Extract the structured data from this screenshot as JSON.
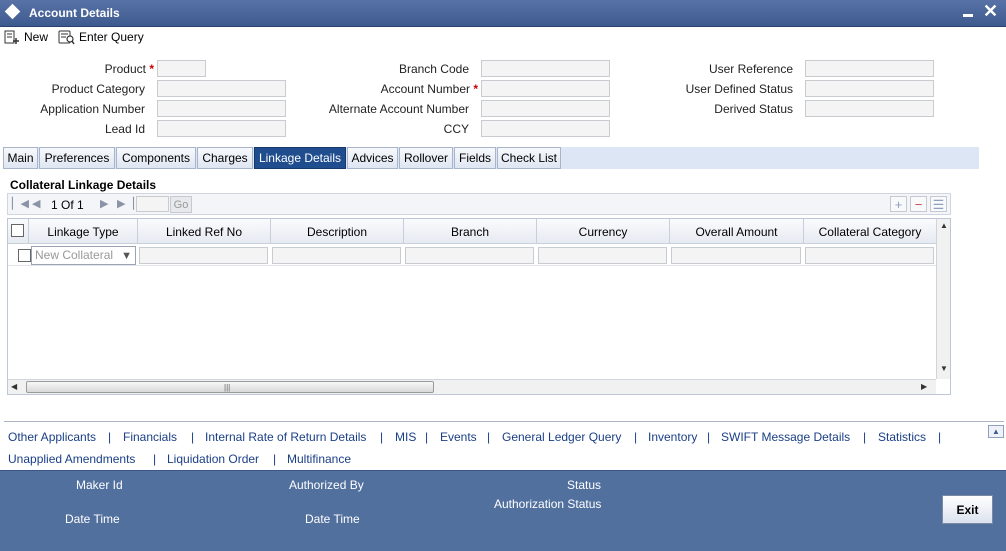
{
  "window": {
    "title": "Account Details"
  },
  "toolbar": {
    "new_label": "New",
    "enter_query_label": "Enter Query"
  },
  "form": {
    "product": "Product",
    "product_category": "Product Category",
    "application_number": "Application Number",
    "lead_id": "Lead Id",
    "branch_code": "Branch Code",
    "account_number": "Account Number",
    "alternate_account_number": "Alternate Account Number",
    "ccy": "CCY",
    "user_reference": "User Reference",
    "user_defined_status": "User Defined Status",
    "derived_status": "Derived Status",
    "required_mark": "*"
  },
  "tabs": [
    {
      "label": "Main"
    },
    {
      "label": "Preferences"
    },
    {
      "label": "Components"
    },
    {
      "label": "Charges"
    },
    {
      "label": "Linkage Details"
    },
    {
      "label": "Advices"
    },
    {
      "label": "Rollover"
    },
    {
      "label": "Fields"
    },
    {
      "label": "Check List"
    }
  ],
  "section": {
    "title": "Collateral Linkage Details",
    "pager": {
      "text": "1 Of 1",
      "go_label": "Go"
    },
    "columns": [
      "Linkage Type",
      "Linked Ref No",
      "Description",
      "Branch",
      "Currency",
      "Overall Amount",
      "Collateral Category"
    ],
    "row": {
      "linkage_type_value": "New Collateral"
    }
  },
  "links": {
    "row1": [
      "Other Applicants",
      "Financials",
      "Internal Rate of Return Details",
      "MIS",
      "Events",
      "General Ledger Query",
      "Inventory",
      "SWIFT Message Details",
      "Statistics"
    ],
    "row2": [
      "Unapplied Amendments",
      "Liquidation Order",
      "Multifinance"
    ],
    "separator": "|"
  },
  "footer": {
    "maker_id": "Maker Id",
    "date_time": "Date Time",
    "authorized_by": "Authorized By",
    "date_time_2": "Date Time",
    "status": "Status",
    "authorization_status": "Authorization Status",
    "exit_label": "Exit"
  },
  "colors": {
    "title_bar": "#3d5a8f",
    "active_tab": "#1f4d8e",
    "footer": "#51709e",
    "link": "#1a3f86"
  }
}
